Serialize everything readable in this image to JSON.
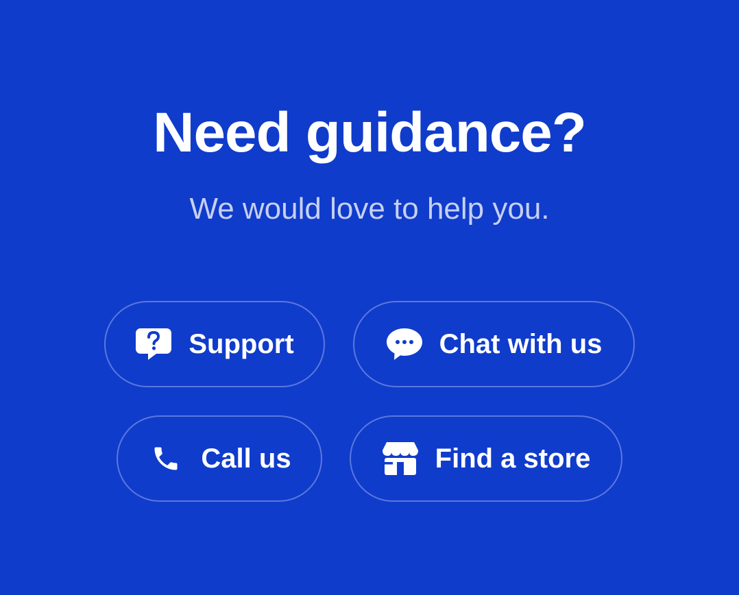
{
  "header": {
    "title": "Need guidance?",
    "subtitle": "We would love to help you."
  },
  "actions": [
    {
      "label": "Support",
      "icon": "question-bubble-icon"
    },
    {
      "label": "Chat with us",
      "icon": "chat-bubble-icon"
    },
    {
      "label": "Call us",
      "icon": "phone-icon"
    },
    {
      "label": "Find a store",
      "icon": "storefront-icon"
    }
  ],
  "colors": {
    "background": "#103ccb",
    "text": "#ffffff",
    "subtitle": "#c6d0f3",
    "border": "#5a78e0"
  }
}
